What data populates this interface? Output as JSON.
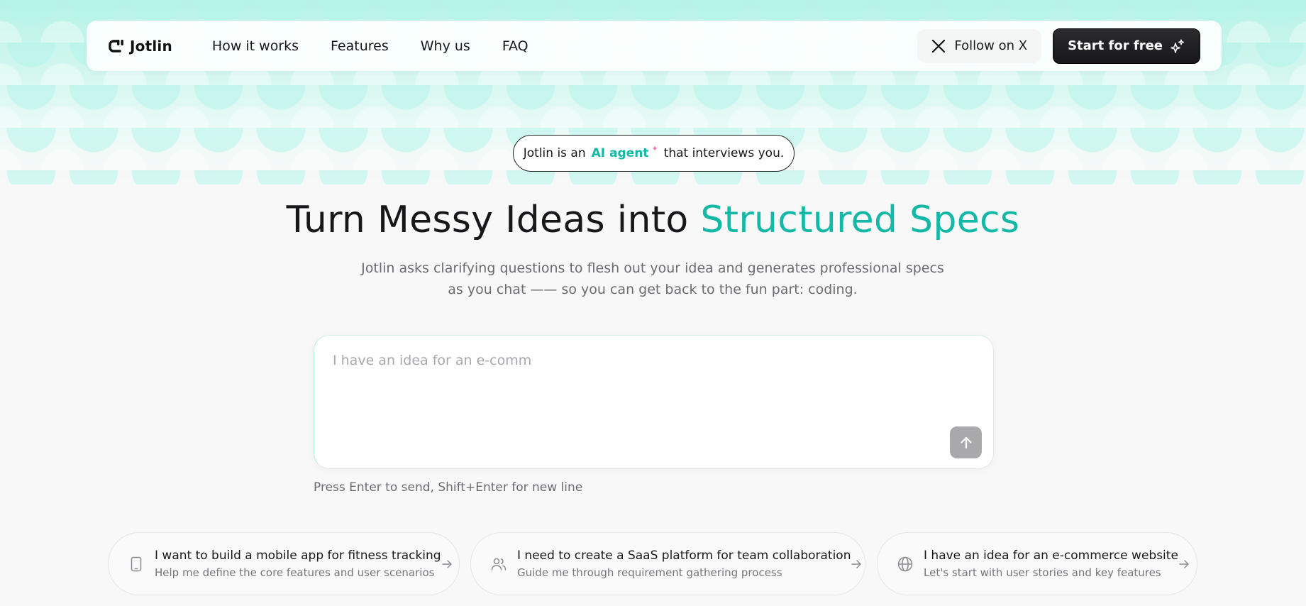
{
  "nav": {
    "logo_text": "Jotlin",
    "links": [
      "How it works",
      "Features",
      "Why us",
      "FAQ"
    ],
    "follow_label": "Follow on X",
    "start_label": "Start for free"
  },
  "hero": {
    "pill_prefix": "Jotlin is an",
    "pill_highlight": "AI agent",
    "pill_suffix": "that interviews you.",
    "headline_main": "Turn Messy Ideas into",
    "headline_accent": "Structured Specs",
    "subtitle": "Jotlin asks clarifying questions to flesh out your idea and generates professional specs as you chat —— so you can get back to the fun part: coding."
  },
  "prompt": {
    "placeholder": "I have an idea for an e-comm",
    "value": "",
    "hint": "Press Enter to send, Shift+Enter for new line"
  },
  "suggestions": [
    {
      "icon": "smartphone-icon",
      "title": "I want to build a mobile app for fitness tracking",
      "subtitle": "Help me define the core features and user scenarios"
    },
    {
      "icon": "users-icon",
      "title": "I need to create a SaaS platform for team collaboration",
      "subtitle": "Guide me through requirement gathering process"
    },
    {
      "icon": "globe-icon",
      "title": "I have an idea for an e-commerce website",
      "subtitle": "Let's start with user stories and key features"
    }
  ],
  "colors": {
    "accent": "#14b8a6",
    "dark_button": "#18181b",
    "star": "#f472b6",
    "background": "#f8f8f8"
  }
}
